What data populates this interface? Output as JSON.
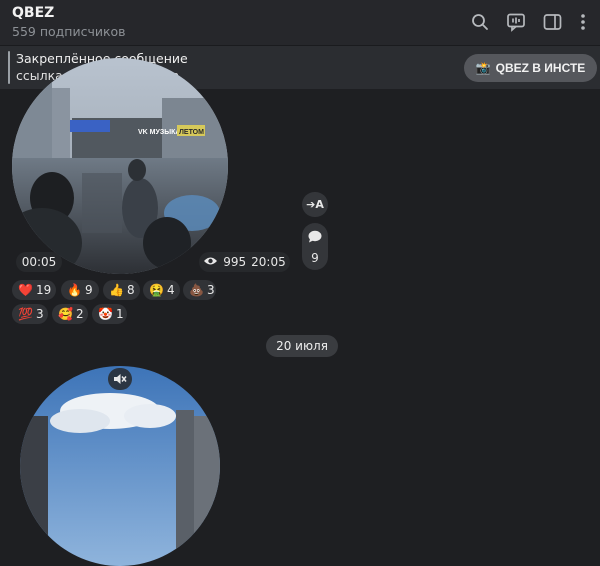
{
  "header": {
    "title": "QBEZ",
    "subscribers": "559 подписчиков",
    "icons": [
      "search-icon",
      "live-chat-icon",
      "sidebar-icon",
      "more-icon"
    ]
  },
  "pinned": {
    "title": "Закреплённое сообщение",
    "text": "ссылка на мой instagram",
    "button_label": "QBEZ В ИНСТЕ",
    "button_emoji": "📸"
  },
  "message1": {
    "video_time": "00:05",
    "views": "995",
    "time": "20:05",
    "comments_count": "9",
    "share_label": "➔A",
    "video_signs": {
      "banner1": "VK МУЗЫКА",
      "banner2": "ЛЕТОМ"
    },
    "reactions_row1": [
      {
        "emoji": "❤️",
        "count": "19"
      },
      {
        "emoji": "🔥",
        "count": "9"
      },
      {
        "emoji": "👍",
        "count": "8"
      },
      {
        "emoji": "🤮",
        "count": "4"
      },
      {
        "emoji": "💩",
        "count": "3"
      }
    ],
    "reactions_row2": [
      {
        "emoji": "💯",
        "count": "3"
      },
      {
        "emoji": "🥰",
        "count": "2"
      },
      {
        "emoji": "🤡",
        "count": "1"
      }
    ]
  },
  "date_separator": "20 июля",
  "message2": {
    "icons": [
      "mute-icon"
    ]
  },
  "colors": {
    "background": "#1e1f22",
    "header": "#26272b",
    "pinned": "#2b2d31",
    "pill": "#313337",
    "accent_heart": "#e0313a"
  }
}
